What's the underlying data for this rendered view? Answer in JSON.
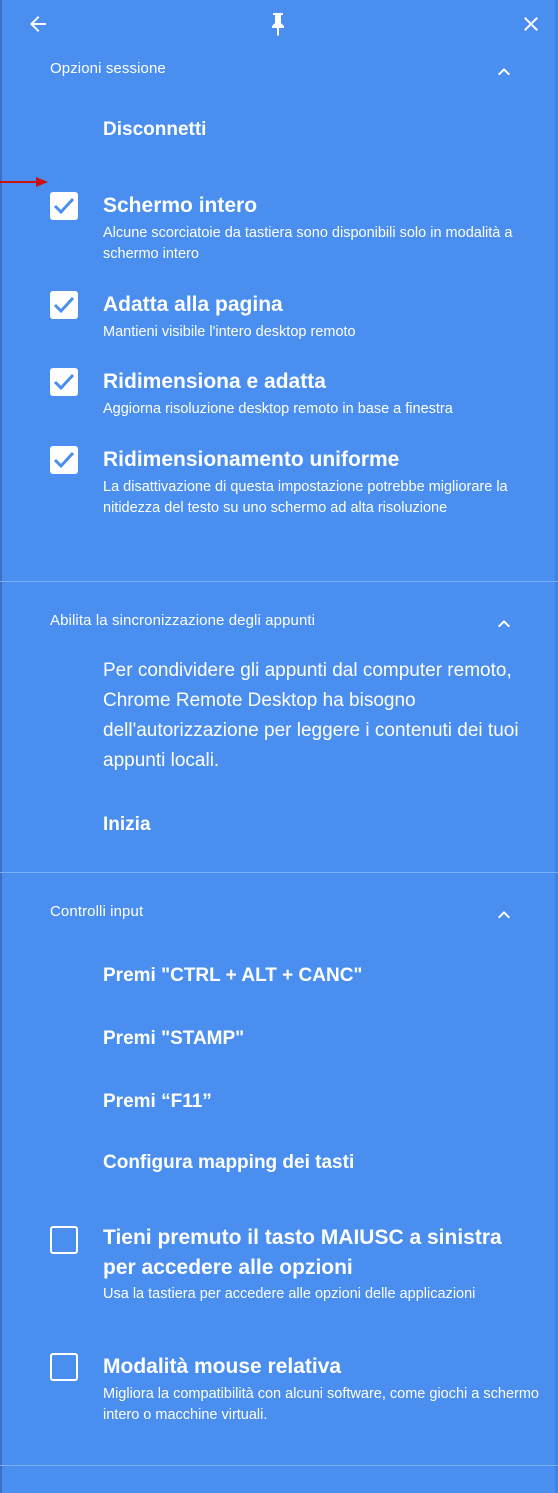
{
  "colors": {
    "panel_bg": "#4a8ff0",
    "text": "#ffffff",
    "divider": "#7ab0f5",
    "pointer_arrow": "#cc1111"
  },
  "topbar": {
    "back_icon": "arrow-left-icon",
    "pin_icon": "pin-icon",
    "close_icon": "close-icon"
  },
  "session": {
    "title": "Opzioni sessione",
    "disconnect_label": "Disconnetti",
    "options": [
      {
        "title": "Schermo intero",
        "desc": "Alcune scorciatoie da tastiera sono disponibili solo in modalità a schermo intero",
        "checked": true
      },
      {
        "title": "Adatta alla pagina",
        "desc": "Mantieni visibile l'intero desktop remoto",
        "checked": true
      },
      {
        "title": "Ridimensiona e adatta",
        "desc": "Aggiorna risoluzione desktop remoto in base a finestra",
        "checked": true
      },
      {
        "title": "Ridimensionamento uniforme",
        "desc": "La disattivazione di questa impostazione potrebbe migliorare la nitidezza del testo su uno schermo ad alta risoluzione",
        "checked": true
      }
    ]
  },
  "clipboard": {
    "title": "Abilita la sincronizzazione degli appunti",
    "text": "Per condividere gli appunti dal computer remoto, Chrome Remote Desktop ha bisogno dell'autorizzazione per leggere i contenuti dei tuoi appunti locali.",
    "start_label": "Inizia"
  },
  "input": {
    "title": "Controlli input",
    "actions": [
      "Premi \"CTRL + ALT + CANC\"",
      "Premi \"STAMP\"",
      "Premi “F11”",
      "Configura mapping dei tasti"
    ],
    "options": [
      {
        "title": "Tieni premuto il tasto MAIUSC a sinistra per accedere alle opzioni",
        "desc": "Usa la tastiera per accedere alle opzioni delle applicazioni",
        "checked": false
      },
      {
        "title": "Modalità mouse relativa",
        "desc": "Migliora la compatibilità con alcuni software, come giochi a schermo intero o macchine virtuali.",
        "checked": false
      }
    ]
  }
}
